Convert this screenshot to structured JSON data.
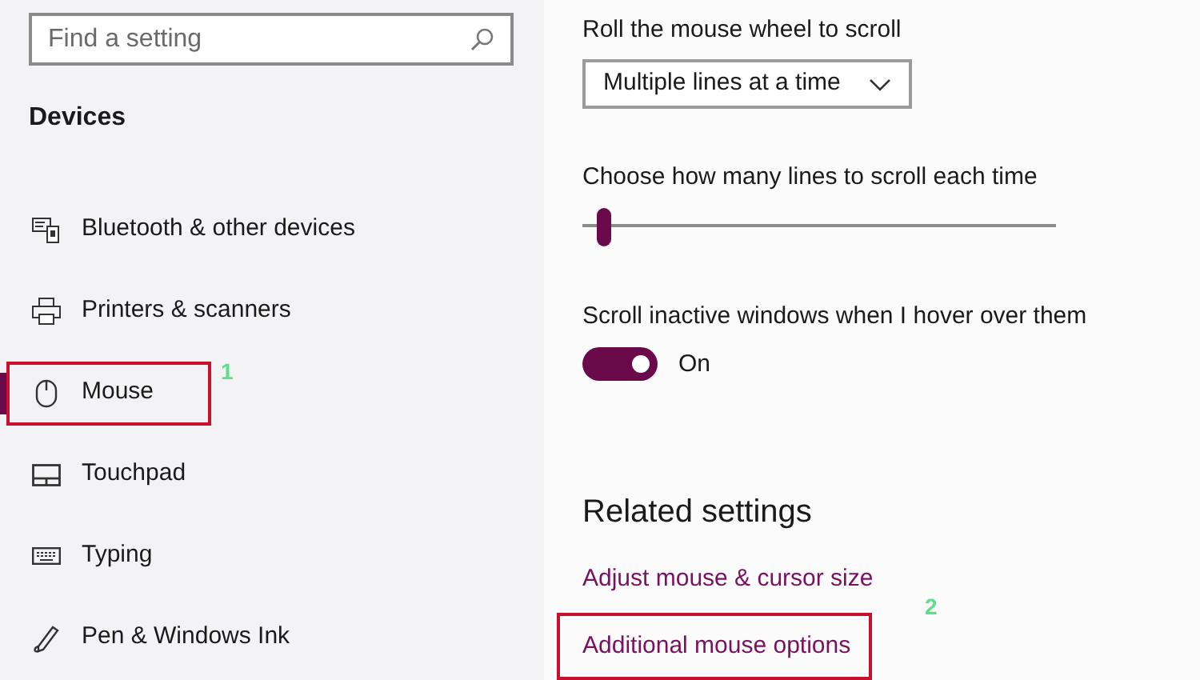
{
  "sidebar": {
    "search": {
      "placeholder": "Find a setting"
    },
    "heading": "Devices",
    "items": [
      {
        "label": "Bluetooth & other devices",
        "kind": "bluetooth",
        "selected": false,
        "highlighted": false
      },
      {
        "label": "Printers & scanners",
        "kind": "printer",
        "selected": false,
        "highlighted": false
      },
      {
        "label": "Mouse",
        "kind": "mouse",
        "selected": true,
        "highlighted": true,
        "annotation": "1"
      },
      {
        "label": "Touchpad",
        "kind": "touchpad",
        "selected": false,
        "highlighted": false
      },
      {
        "label": "Typing",
        "kind": "keyboard",
        "selected": false,
        "highlighted": false
      },
      {
        "label": "Pen & Windows Ink",
        "kind": "pen",
        "selected": false,
        "highlighted": false
      }
    ]
  },
  "content": {
    "wheel_label": "Roll the mouse wheel to scroll",
    "wheel_dropdown": "Multiple lines at a time",
    "lines_label": "Choose how many lines to scroll each time",
    "lines_slider": {
      "level": 0.03
    },
    "inactive_label": "Scroll inactive windows when I hover over them",
    "inactive_toggle": {
      "on": true,
      "state_text": "On"
    },
    "related_heading": "Related settings",
    "links": [
      {
        "label": "Adjust mouse & cursor size",
        "highlighted": false
      },
      {
        "label": "Additional mouse options",
        "highlighted": true,
        "annotation": "2"
      }
    ]
  }
}
